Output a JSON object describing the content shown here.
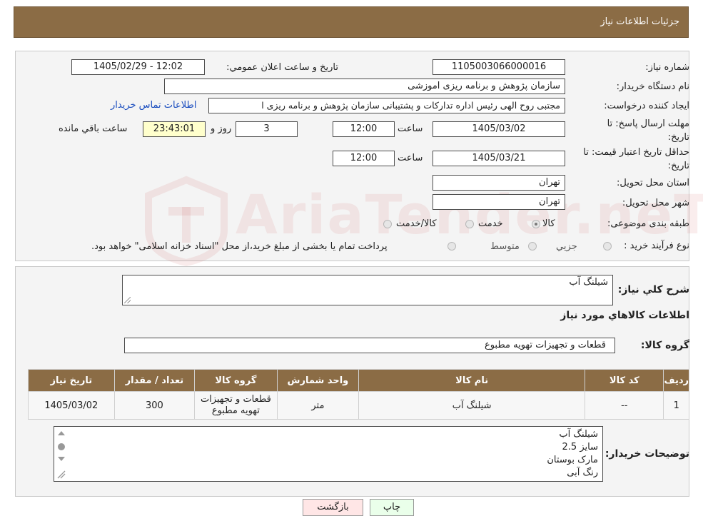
{
  "header": {
    "title": "جزئیات اطلاعات نیاز"
  },
  "form": {
    "need_number_label": "شماره نیاز:",
    "need_number": "1105003066000016",
    "announce_label": "تاريخ و ساعت اعلان عمومي:",
    "announce_value": "1405/02/29 - 12:02",
    "buyer_label": "نام دستگاه خريدار:",
    "buyer_value": "سازمان پژوهش و برنامه ریزی اموزشی",
    "creator_label": "ايجاد کننده درخواست:",
    "creator_value": "مجتبی روح الهی رئیس اداره تدارکات و پشتیبانی سازمان پژوهش و برنامه ریزی ا",
    "contact_link": "اطلاعات تماس خريدار",
    "deadline_label_line1": "مهلت ارسال پاسخ: تا",
    "deadline_label_line2": "تاريخ:",
    "deadline_date": "1405/03/02",
    "time_label": "ساعت",
    "deadline_time": "12:00",
    "days_value": "3",
    "days_label": "روز و",
    "remaining_value": "23:43:01",
    "remaining_label": "ساعت باقي مانده",
    "validity_label_line1": "حداقل تاريخ اعتبار قيمت: تا",
    "validity_label_line2": "تاريخ:",
    "validity_date": "1405/03/21",
    "validity_time": "12:00",
    "province_label": "استان محل تحويل:",
    "province_value": "تهران",
    "city_label": "شهر محل تحويل:",
    "city_value": "تهران",
    "category_label": "طبقه بندی موضوعی:",
    "category_options": [
      "کالا",
      "خدمت",
      "کالا/خدمت"
    ],
    "category_selected": "کالا",
    "process_label": "نوع فرآيند خريد :",
    "process_options": [
      "جزيي",
      "متوسط"
    ],
    "process_note": "پرداخت تمام يا بخشی از مبلغ خريد،از محل \"اسناد خزانه اسلامی\" خواهد بود."
  },
  "details": {
    "summary_label": "شرح کلي نياز:",
    "summary_value": "شیلنگ آب",
    "goods_info_title": "اطلاعات کالاهاي مورد نياز",
    "goods_group_label": "گروه کالا:",
    "goods_group_value": "قطعات و تجهیزات تهویه مطبوع",
    "table_headers": [
      "رديف",
      "کد کالا",
      "نام کالا",
      "واحد شمارش",
      "گروه کالا",
      "تعداد / مقدار",
      "تاريخ نياز"
    ],
    "rows": [
      {
        "index": "1",
        "code": "--",
        "name": "شیلنگ آب",
        "unit": "متر",
        "group": "قطعات و تجهیزات تهویه مطبوع",
        "qty": "300",
        "date": "1405/03/02"
      }
    ],
    "buyer_notes_label": "توضيحات خريدار:",
    "buyer_notes_lines": [
      "شیلنگ آب",
      "سایز 2.5",
      "مارک بوستان",
      "رنگ آبی"
    ]
  },
  "buttons": {
    "print": "چاپ",
    "back": "بازگشت"
  },
  "watermark": "AriaTender.neT",
  "colors": {
    "header_brown": "#8b6c45",
    "link_blue": "#1a4dbf",
    "remaining_yellow": "#ffffcc",
    "print_green": "#eaffea",
    "back_pink": "#ffe6e6"
  }
}
